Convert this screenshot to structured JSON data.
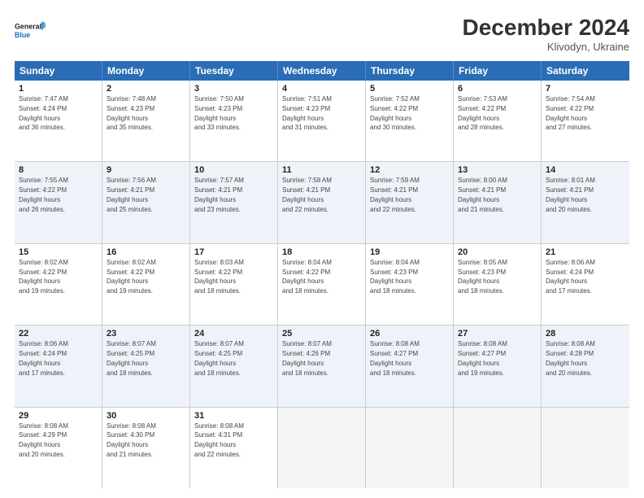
{
  "header": {
    "logo_line1": "General",
    "logo_line2": "Blue",
    "title": "December 2024",
    "subtitle": "Klivodyn, Ukraine"
  },
  "days_of_week": [
    "Sunday",
    "Monday",
    "Tuesday",
    "Wednesday",
    "Thursday",
    "Friday",
    "Saturday"
  ],
  "weeks": [
    [
      {
        "day": "1",
        "sunrise": "7:47 AM",
        "sunset": "4:24 PM",
        "daylight": "8 hours and 36 minutes."
      },
      {
        "day": "2",
        "sunrise": "7:48 AM",
        "sunset": "4:23 PM",
        "daylight": "8 hours and 35 minutes."
      },
      {
        "day": "3",
        "sunrise": "7:50 AM",
        "sunset": "4:23 PM",
        "daylight": "8 hours and 33 minutes."
      },
      {
        "day": "4",
        "sunrise": "7:51 AM",
        "sunset": "4:23 PM",
        "daylight": "8 hours and 31 minutes."
      },
      {
        "day": "5",
        "sunrise": "7:52 AM",
        "sunset": "4:22 PM",
        "daylight": "8 hours and 30 minutes."
      },
      {
        "day": "6",
        "sunrise": "7:53 AM",
        "sunset": "4:22 PM",
        "daylight": "8 hours and 28 minutes."
      },
      {
        "day": "7",
        "sunrise": "7:54 AM",
        "sunset": "4:22 PM",
        "daylight": "8 hours and 27 minutes."
      }
    ],
    [
      {
        "day": "8",
        "sunrise": "7:55 AM",
        "sunset": "4:22 PM",
        "daylight": "8 hours and 26 minutes."
      },
      {
        "day": "9",
        "sunrise": "7:56 AM",
        "sunset": "4:21 PM",
        "daylight": "8 hours and 25 minutes."
      },
      {
        "day": "10",
        "sunrise": "7:57 AM",
        "sunset": "4:21 PM",
        "daylight": "8 hours and 23 minutes."
      },
      {
        "day": "11",
        "sunrise": "7:58 AM",
        "sunset": "4:21 PM",
        "daylight": "8 hours and 22 minutes."
      },
      {
        "day": "12",
        "sunrise": "7:59 AM",
        "sunset": "4:21 PM",
        "daylight": "8 hours and 22 minutes."
      },
      {
        "day": "13",
        "sunrise": "8:00 AM",
        "sunset": "4:21 PM",
        "daylight": "8 hours and 21 minutes."
      },
      {
        "day": "14",
        "sunrise": "8:01 AM",
        "sunset": "4:21 PM",
        "daylight": "8 hours and 20 minutes."
      }
    ],
    [
      {
        "day": "15",
        "sunrise": "8:02 AM",
        "sunset": "4:22 PM",
        "daylight": "8 hours and 19 minutes."
      },
      {
        "day": "16",
        "sunrise": "8:02 AM",
        "sunset": "4:22 PM",
        "daylight": "8 hours and 19 minutes."
      },
      {
        "day": "17",
        "sunrise": "8:03 AM",
        "sunset": "4:22 PM",
        "daylight": "8 hours and 18 minutes."
      },
      {
        "day": "18",
        "sunrise": "8:04 AM",
        "sunset": "4:22 PM",
        "daylight": "8 hours and 18 minutes."
      },
      {
        "day": "19",
        "sunrise": "8:04 AM",
        "sunset": "4:23 PM",
        "daylight": "8 hours and 18 minutes."
      },
      {
        "day": "20",
        "sunrise": "8:05 AM",
        "sunset": "4:23 PM",
        "daylight": "8 hours and 18 minutes."
      },
      {
        "day": "21",
        "sunrise": "8:06 AM",
        "sunset": "4:24 PM",
        "daylight": "8 hours and 17 minutes."
      }
    ],
    [
      {
        "day": "22",
        "sunrise": "8:06 AM",
        "sunset": "4:24 PM",
        "daylight": "8 hours and 17 minutes."
      },
      {
        "day": "23",
        "sunrise": "8:07 AM",
        "sunset": "4:25 PM",
        "daylight": "8 hours and 18 minutes."
      },
      {
        "day": "24",
        "sunrise": "8:07 AM",
        "sunset": "4:25 PM",
        "daylight": "8 hours and 18 minutes."
      },
      {
        "day": "25",
        "sunrise": "8:07 AM",
        "sunset": "4:26 PM",
        "daylight": "8 hours and 18 minutes."
      },
      {
        "day": "26",
        "sunrise": "8:08 AM",
        "sunset": "4:27 PM",
        "daylight": "8 hours and 18 minutes."
      },
      {
        "day": "27",
        "sunrise": "8:08 AM",
        "sunset": "4:27 PM",
        "daylight": "8 hours and 19 minutes."
      },
      {
        "day": "28",
        "sunrise": "8:08 AM",
        "sunset": "4:28 PM",
        "daylight": "8 hours and 20 minutes."
      }
    ],
    [
      {
        "day": "29",
        "sunrise": "8:08 AM",
        "sunset": "4:29 PM",
        "daylight": "8 hours and 20 minutes."
      },
      {
        "day": "30",
        "sunrise": "8:08 AM",
        "sunset": "4:30 PM",
        "daylight": "8 hours and 21 minutes."
      },
      {
        "day": "31",
        "sunrise": "8:08 AM",
        "sunset": "4:31 PM",
        "daylight": "8 hours and 22 minutes."
      },
      null,
      null,
      null,
      null
    ]
  ]
}
